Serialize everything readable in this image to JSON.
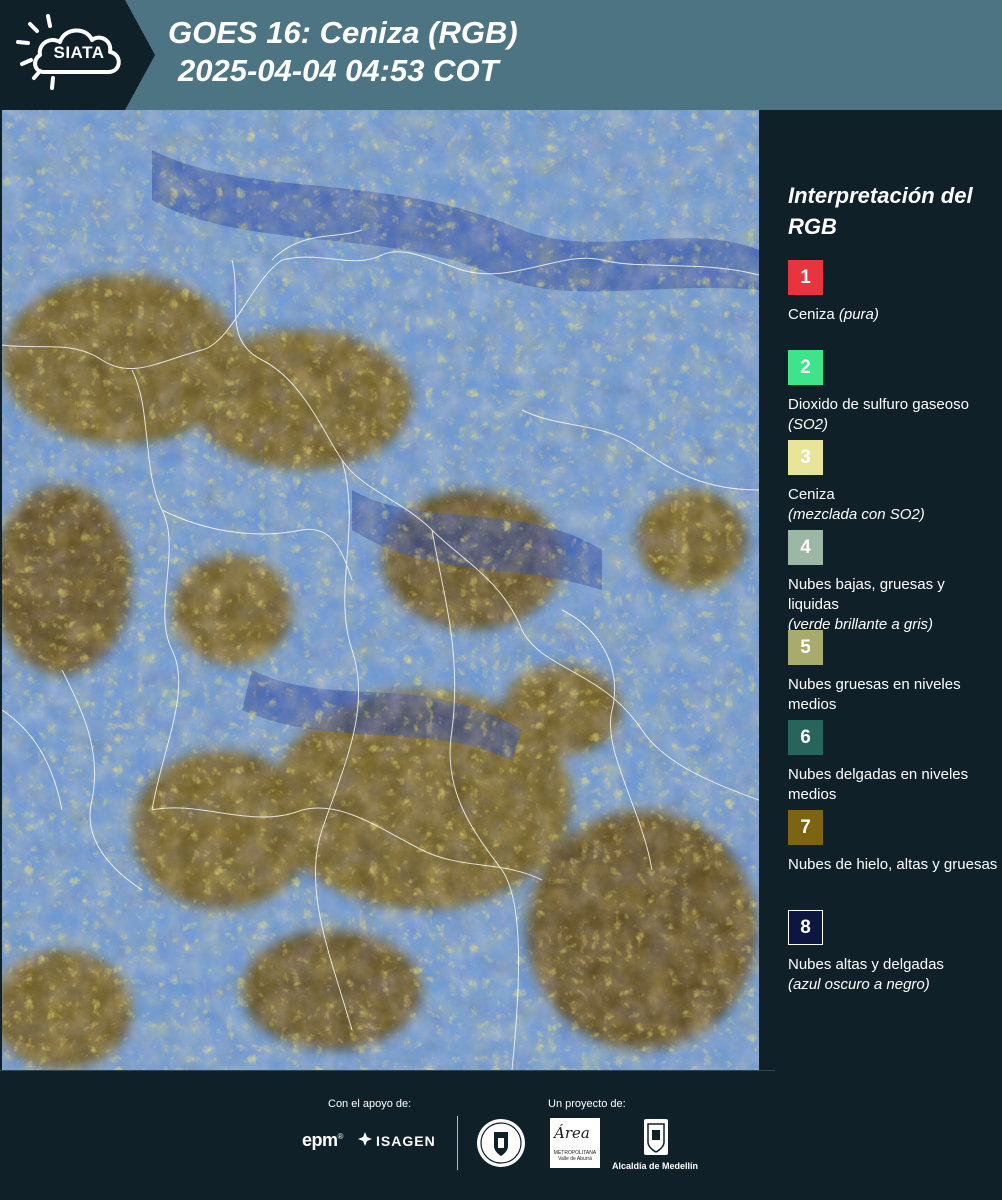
{
  "header": {
    "logo": "SIATA",
    "title": "GOES 16: Ceniza (RGB)",
    "datetime": "2025-04-04 04:53 COT"
  },
  "map": {
    "icon": "satellite-ash-rgb-image",
    "palette": {
      "ocean_cloud": "#5a8ad6",
      "bright_cyan": "#9ccaf0",
      "deep_blue": "#1f3fa0",
      "olive": "#6b5a24",
      "olive_dark": "#4a3d16",
      "yellow": "#e6c93a",
      "borders": "#ffffff"
    }
  },
  "legend": {
    "title": "Interpretación del RGB",
    "items": [
      {
        "number": "1",
        "color": "#e8343c",
        "text_color": "#ffffff",
        "label": "Ceniza",
        "note": "(pura)",
        "note_newline": false
      },
      {
        "number": "2",
        "color": "#3fe38a",
        "text_color": "#ffffff",
        "label": "Dioxido de sulfuro gaseoso",
        "note": "(SO2)",
        "note_newline": false
      },
      {
        "number": "3",
        "color": "#e8e49a",
        "text_color": "#ffffff",
        "label": "Ceniza",
        "note": "(mezclada con SO2)",
        "note_newline": true
      },
      {
        "number": "4",
        "color": "#9db7a5",
        "text_color": "#ffffff",
        "label": "Nubes bajas, gruesas y liquidas",
        "note": "(verde brillante a gris)",
        "note_newline": true
      },
      {
        "number": "5",
        "color": "#a9ab6c",
        "text_color": "#ffffff",
        "label": "Nubes gruesas en niveles medios",
        "note": "",
        "note_newline": false
      },
      {
        "number": "6",
        "color": "#26645c",
        "text_color": "#ffffff",
        "label": "Nubes delgadas en niveles medios",
        "note": "",
        "note_newline": false
      },
      {
        "number": "7",
        "color": "#7d6412",
        "text_color": "#ffffff",
        "label": "Nubes de hielo, altas y gruesas",
        "note": "",
        "note_newline": false
      },
      {
        "number": "8",
        "color": "#0d1640",
        "text_color": "#ffffff",
        "label": "Nubes altas y delgadas",
        "note": "(azul oscuro a negro)",
        "note_newline": true
      }
    ]
  },
  "footer": {
    "support_label": "Con el apoyo de:",
    "project_label": "Un proyecto de:",
    "epm": "epm",
    "epm_mark": "®",
    "isagen": "ISAGEN",
    "area_name": "Área",
    "area_sub": "METROPOLITANA Valle de Aburrá",
    "alcaldia": "Alcaldía de Medellín"
  }
}
